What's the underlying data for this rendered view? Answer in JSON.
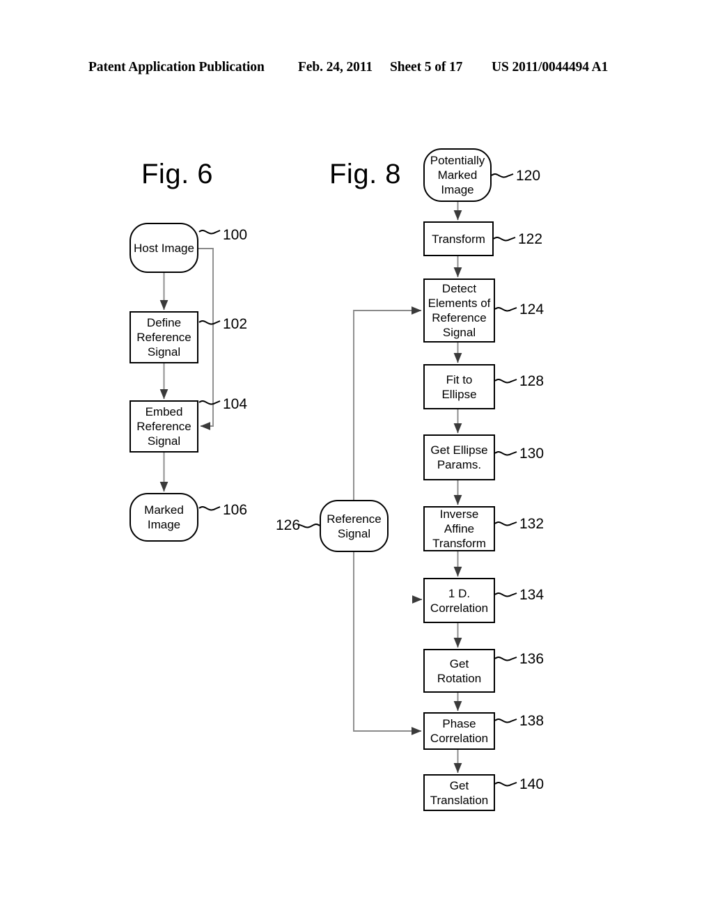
{
  "header": {
    "publication": "Patent Application Publication",
    "date": "Feb. 24, 2011",
    "sheet": "Sheet 5 of 17",
    "doc_number": "US 2011/0044494 A1"
  },
  "figures": [
    {
      "id": "fig6",
      "title": "Fig. 6",
      "nodes": [
        {
          "id": "n100",
          "label": "Host Image",
          "ref": "100",
          "shape": "rounded"
        },
        {
          "id": "n102",
          "label": "Define\nReference\nSignal",
          "ref": "102",
          "shape": "rect"
        },
        {
          "id": "n104",
          "label": "Embed\nReference\nSignal",
          "ref": "104",
          "shape": "rect"
        },
        {
          "id": "n106",
          "label": "Marked\nImage",
          "ref": "106",
          "shape": "rounded"
        }
      ]
    },
    {
      "id": "fig8",
      "title": "Fig. 8",
      "nodes": [
        {
          "id": "n120",
          "label": "Potentially\nMarked\nImage",
          "ref": "120",
          "shape": "rounded"
        },
        {
          "id": "n122",
          "label": "Transform",
          "ref": "122",
          "shape": "rect"
        },
        {
          "id": "n124",
          "label": "Detect\nElements of\nReference\nSignal",
          "ref": "124",
          "shape": "rect"
        },
        {
          "id": "n128",
          "label": "Fit to\nEllipse",
          "ref": "128",
          "shape": "rect"
        },
        {
          "id": "n130",
          "label": "Get Ellipse\nParams.",
          "ref": "130",
          "shape": "rect"
        },
        {
          "id": "n132",
          "label": "Inverse\nAffine\nTransform",
          "ref": "132",
          "shape": "rect"
        },
        {
          "id": "n134",
          "label": "1 D.\nCorrelation",
          "ref": "134",
          "shape": "rect"
        },
        {
          "id": "n136",
          "label": "Get\nRotation",
          "ref": "136",
          "shape": "rect"
        },
        {
          "id": "n138",
          "label": "Phase\nCorrelation",
          "ref": "138",
          "shape": "rect"
        },
        {
          "id": "n140",
          "label": "Get\nTranslation",
          "ref": "140",
          "shape": "rect"
        },
        {
          "id": "n126",
          "label": "Reference\nSignal",
          "ref": "126",
          "shape": "rounded"
        }
      ]
    }
  ],
  "colors": {
    "ink": "#000000",
    "paper": "#ffffff",
    "wire": "#808080"
  }
}
